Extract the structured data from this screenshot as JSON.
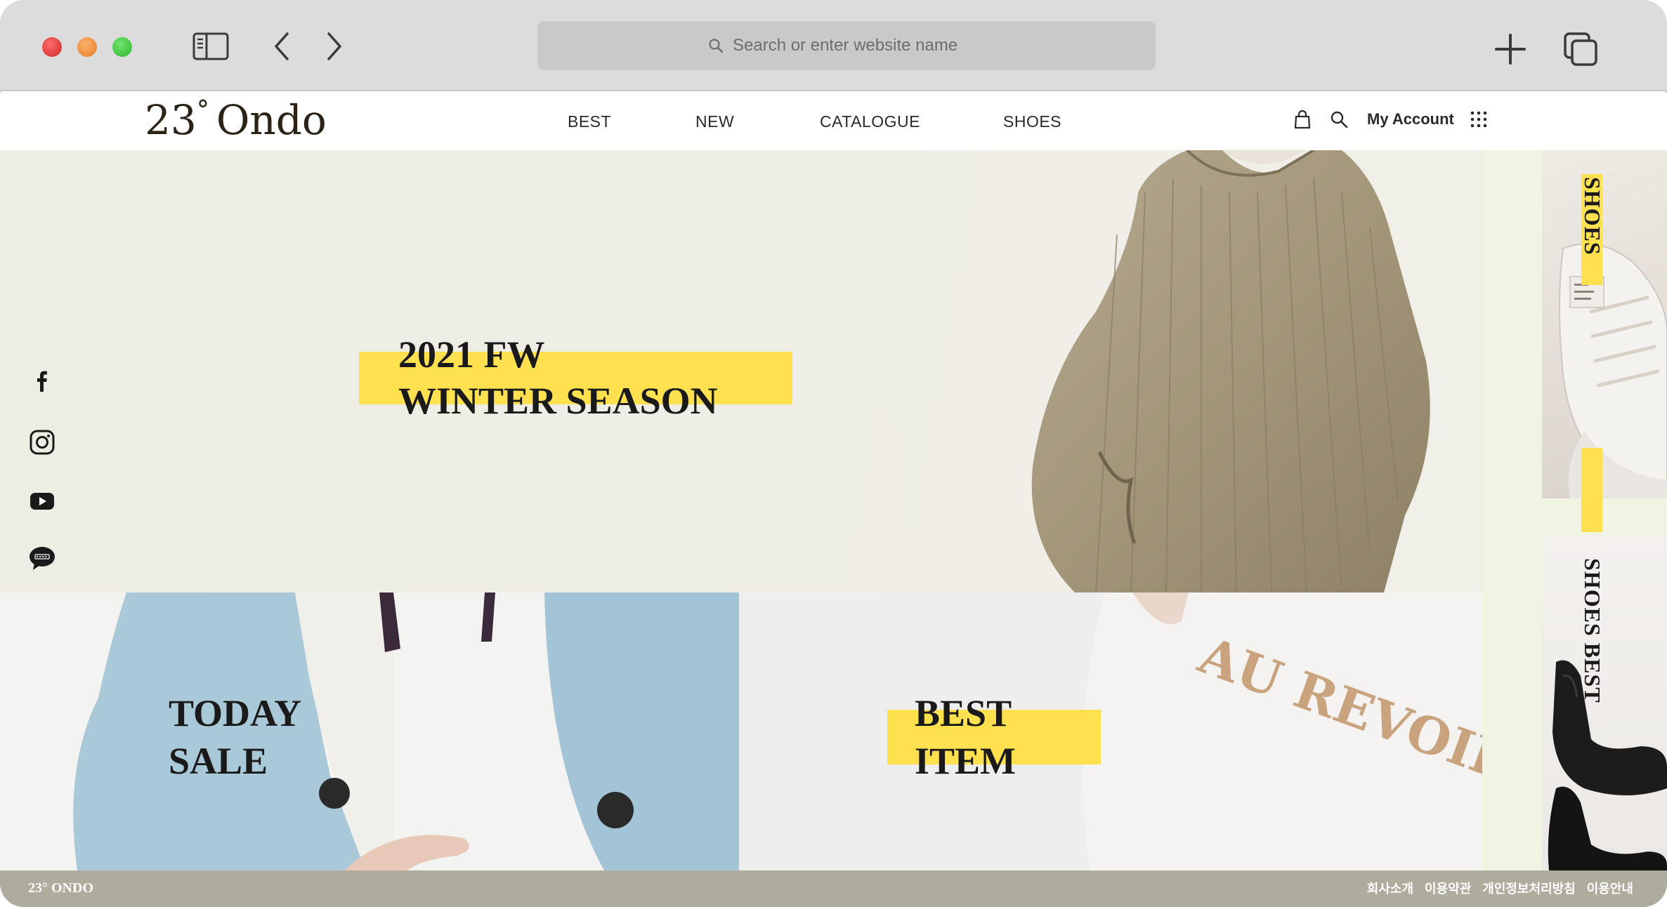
{
  "browser": {
    "address_placeholder": "Search or enter website name",
    "icons": [
      "sidebar-icon",
      "back-icon",
      "forward-icon",
      "search-icon",
      "new-tab-icon",
      "tabs-overview-icon"
    ],
    "traffic_light_colors": [
      "#d0282a",
      "#e07a2c",
      "#2fb82f"
    ]
  },
  "site": {
    "logo_number": "23",
    "logo_degree": "°",
    "logo_name": "Ondo",
    "nav": [
      {
        "label": "BEST"
      },
      {
        "label": "NEW"
      },
      {
        "label": "CATALOGUE"
      },
      {
        "label": "SHOES"
      }
    ],
    "header_icons": [
      "bag-icon",
      "search-icon",
      "grid-menu-icon"
    ],
    "account_label": "My Account"
  },
  "hero": {
    "title_line1": "2021 FW",
    "title_line2": "WINTER SEASON",
    "accent_color": "#ffe14f"
  },
  "social": [
    "facebook-icon",
    "instagram-icon",
    "youtube-icon",
    "kakaotalk-icon"
  ],
  "side_cards": {
    "shoes_label": "SHOES",
    "shoes_best_label": "SHOES BEST"
  },
  "tiles": {
    "sale_line1": "TODAY",
    "sale_line2": "SALE",
    "best_line1": "BEST",
    "best_line2": "ITEM",
    "shirt_print": "AU REVOIR"
  },
  "footer": {
    "logo": "23° ONDO",
    "links": [
      "회사소개",
      "이용약관",
      "개인정보처리방침",
      "이용안내"
    ],
    "color": "#aeac9c"
  }
}
